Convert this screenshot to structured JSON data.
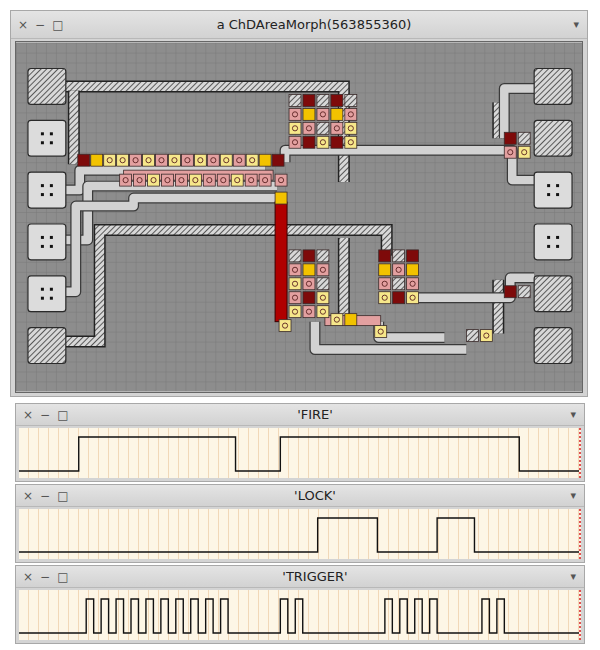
{
  "circuit_window": {
    "title": "a ChDAreaMorph(563855360)",
    "controls": [
      "×",
      "−",
      "□"
    ],
    "menu": "▾"
  },
  "signal_windows": [
    {
      "title": "'FIRE'",
      "controls": [
        "×",
        "−",
        "□"
      ],
      "menu": "▾",
      "values": [
        0,
        0,
        0,
        0,
        0,
        0,
        0,
        0,
        1,
        1,
        1,
        1,
        1,
        1,
        1,
        1,
        1,
        1,
        1,
        1,
        1,
        1,
        1,
        1,
        1,
        1,
        1,
        1,
        1,
        0,
        0,
        0,
        0,
        0,
        0,
        1,
        1,
        1,
        1,
        1,
        1,
        1,
        1,
        1,
        1,
        1,
        1,
        1,
        1,
        1,
        1,
        1,
        1,
        1,
        1,
        1,
        1,
        1,
        1,
        1,
        1,
        1,
        1,
        1,
        1,
        1,
        1,
        0,
        0,
        0,
        0,
        0,
        0,
        0,
        0
      ]
    },
    {
      "title": "'LOCK'",
      "controls": [
        "×",
        "−",
        "□"
      ],
      "menu": "▾",
      "values": [
        0,
        0,
        0,
        0,
        0,
        0,
        0,
        0,
        0,
        0,
        0,
        0,
        0,
        0,
        0,
        0,
        0,
        0,
        0,
        0,
        0,
        0,
        0,
        0,
        0,
        0,
        0,
        0,
        0,
        0,
        0,
        0,
        0,
        0,
        0,
        0,
        0,
        0,
        0,
        0,
        1,
        1,
        1,
        1,
        1,
        1,
        1,
        1,
        0,
        0,
        0,
        0,
        0,
        0,
        0,
        0,
        1,
        1,
        1,
        1,
        1,
        0,
        0,
        0,
        0,
        0,
        0,
        0,
        0,
        0,
        0,
        0,
        0,
        0,
        0
      ]
    },
    {
      "title": "'TRIGGER'",
      "controls": [
        "×",
        "−",
        "□"
      ],
      "menu": "▾",
      "values": [
        0,
        0,
        0,
        0,
        0,
        0,
        0,
        0,
        0,
        1,
        0,
        1,
        0,
        1,
        0,
        1,
        0,
        1,
        0,
        1,
        0,
        1,
        0,
        1,
        0,
        1,
        0,
        1,
        0,
        0,
        0,
        0,
        0,
        0,
        0,
        1,
        0,
        1,
        0,
        0,
        0,
        0,
        0,
        0,
        0,
        0,
        0,
        0,
        0,
        1,
        0,
        1,
        0,
        1,
        0,
        1,
        0,
        0,
        0,
        0,
        0,
        0,
        1,
        0,
        1,
        0,
        0,
        0,
        0,
        0,
        0,
        0,
        0,
        0,
        0
      ]
    }
  ]
}
